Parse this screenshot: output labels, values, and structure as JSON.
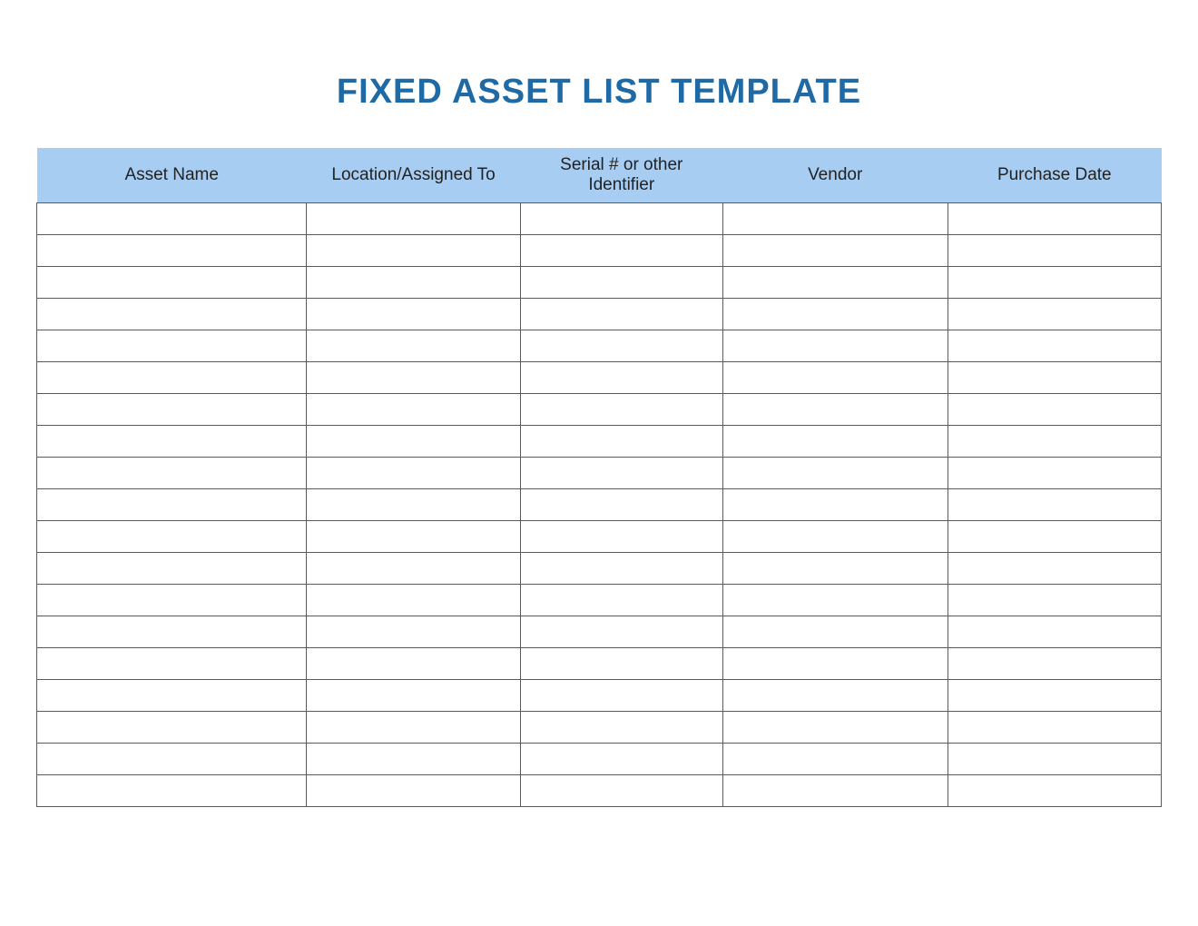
{
  "title": "FIXED ASSET LIST TEMPLATE",
  "columns": [
    "Asset Name",
    "Location/Assigned To",
    "Serial # or other Identifier",
    "Vendor",
    "Purchase Date"
  ],
  "rows": [
    [
      "",
      "",
      "",
      "",
      ""
    ],
    [
      "",
      "",
      "",
      "",
      ""
    ],
    [
      "",
      "",
      "",
      "",
      ""
    ],
    [
      "",
      "",
      "",
      "",
      ""
    ],
    [
      "",
      "",
      "",
      "",
      ""
    ],
    [
      "",
      "",
      "",
      "",
      ""
    ],
    [
      "",
      "",
      "",
      "",
      ""
    ],
    [
      "",
      "",
      "",
      "",
      ""
    ],
    [
      "",
      "",
      "",
      "",
      ""
    ],
    [
      "",
      "",
      "",
      "",
      ""
    ],
    [
      "",
      "",
      "",
      "",
      ""
    ],
    [
      "",
      "",
      "",
      "",
      ""
    ],
    [
      "",
      "",
      "",
      "",
      ""
    ],
    [
      "",
      "",
      "",
      "",
      ""
    ],
    [
      "",
      "",
      "",
      "",
      ""
    ],
    [
      "",
      "",
      "",
      "",
      ""
    ],
    [
      "",
      "",
      "",
      "",
      ""
    ],
    [
      "",
      "",
      "",
      "",
      ""
    ],
    [
      "",
      "",
      "",
      "",
      ""
    ]
  ],
  "colors": {
    "title": "#1f6aa5",
    "header_bg": "#a7cdf2",
    "border": "#5a5a5a"
  }
}
